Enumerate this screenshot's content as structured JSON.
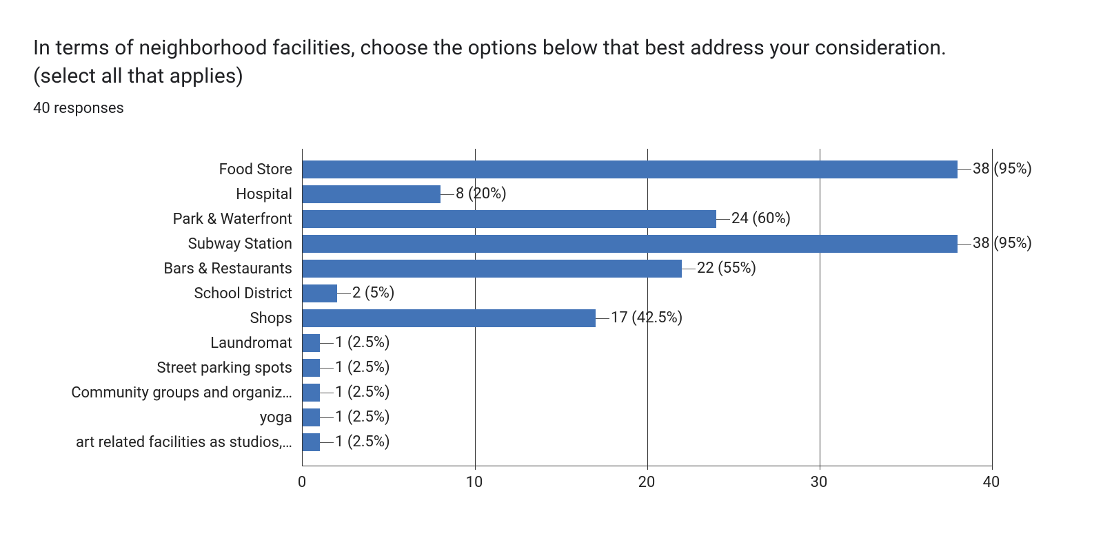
{
  "title": "In terms of neighborhood facilities, choose the options below that best address your consideration.(select all that applies)",
  "responses": "40 responses",
  "chart_data": {
    "type": "bar",
    "orientation": "horizontal",
    "xlim": [
      0,
      40
    ],
    "x_ticks": [
      0,
      10,
      20,
      30,
      40
    ],
    "bar_color": "#4374b7",
    "series": [
      {
        "category": "Food Store",
        "value": 38,
        "pct": "95%",
        "label": "38 (95%)"
      },
      {
        "category": "Hospital",
        "value": 8,
        "pct": "20%",
        "label": "8 (20%)"
      },
      {
        "category": "Park & Waterfront",
        "value": 24,
        "pct": "60%",
        "label": "24 (60%)"
      },
      {
        "category": "Subway Station",
        "value": 38,
        "pct": "95%",
        "label": "38 (95%)"
      },
      {
        "category": "Bars & Restaurants",
        "value": 22,
        "pct": "55%",
        "label": "22 (55%)"
      },
      {
        "category": "School District",
        "value": 2,
        "pct": "5%",
        "label": "2 (5%)"
      },
      {
        "category": "Shops",
        "value": 17,
        "pct": "42.5%",
        "label": "17 (42.5%)"
      },
      {
        "category": "Laundromat",
        "value": 1,
        "pct": "2.5%",
        "label": "1 (2.5%)"
      },
      {
        "category": "Street parking spots",
        "value": 1,
        "pct": "2.5%",
        "label": "1 (2.5%)"
      },
      {
        "category": "Community groups and organiz…",
        "value": 1,
        "pct": "2.5%",
        "label": "1 (2.5%)"
      },
      {
        "category": "yoga",
        "value": 1,
        "pct": "2.5%",
        "label": "1 (2.5%)"
      },
      {
        "category": "art related facilities as studios,…",
        "value": 1,
        "pct": "2.5%",
        "label": "1 (2.5%)"
      }
    ]
  }
}
